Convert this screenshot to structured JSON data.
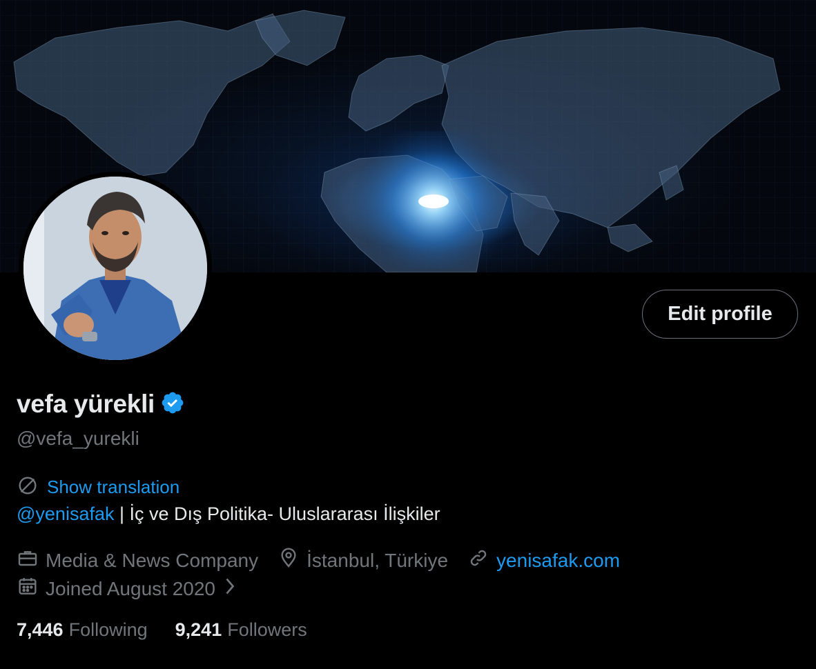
{
  "profile": {
    "display_name": "vefa yürekli",
    "handle": "@vefa_yurekli",
    "verified": true,
    "edit_button_label": "Edit profile",
    "show_translation_label": "Show translation",
    "bio_mention": "@yenisafak",
    "bio_text": " | İç ve Dış Politika- Uluslararası İlişkiler",
    "category": "Media & News Company",
    "location": "İstanbul, Türkiye",
    "website": "yenisafak.com",
    "joined": "Joined August 2020",
    "following_count": "7,446",
    "following_label": "Following",
    "followers_count": "9,241",
    "followers_label": "Followers"
  },
  "icons": {
    "verified": "verified-badge-icon",
    "translate": "translate-globe-icon",
    "category": "briefcase-icon",
    "location": "location-pin-icon",
    "website": "link-icon",
    "joined": "calendar-icon",
    "joined_more": "chevron-right-icon"
  },
  "colors": {
    "background": "#000000",
    "accent": "#1d9bf0",
    "primary_text": "#e7e9ea",
    "secondary_text": "#71767b"
  }
}
